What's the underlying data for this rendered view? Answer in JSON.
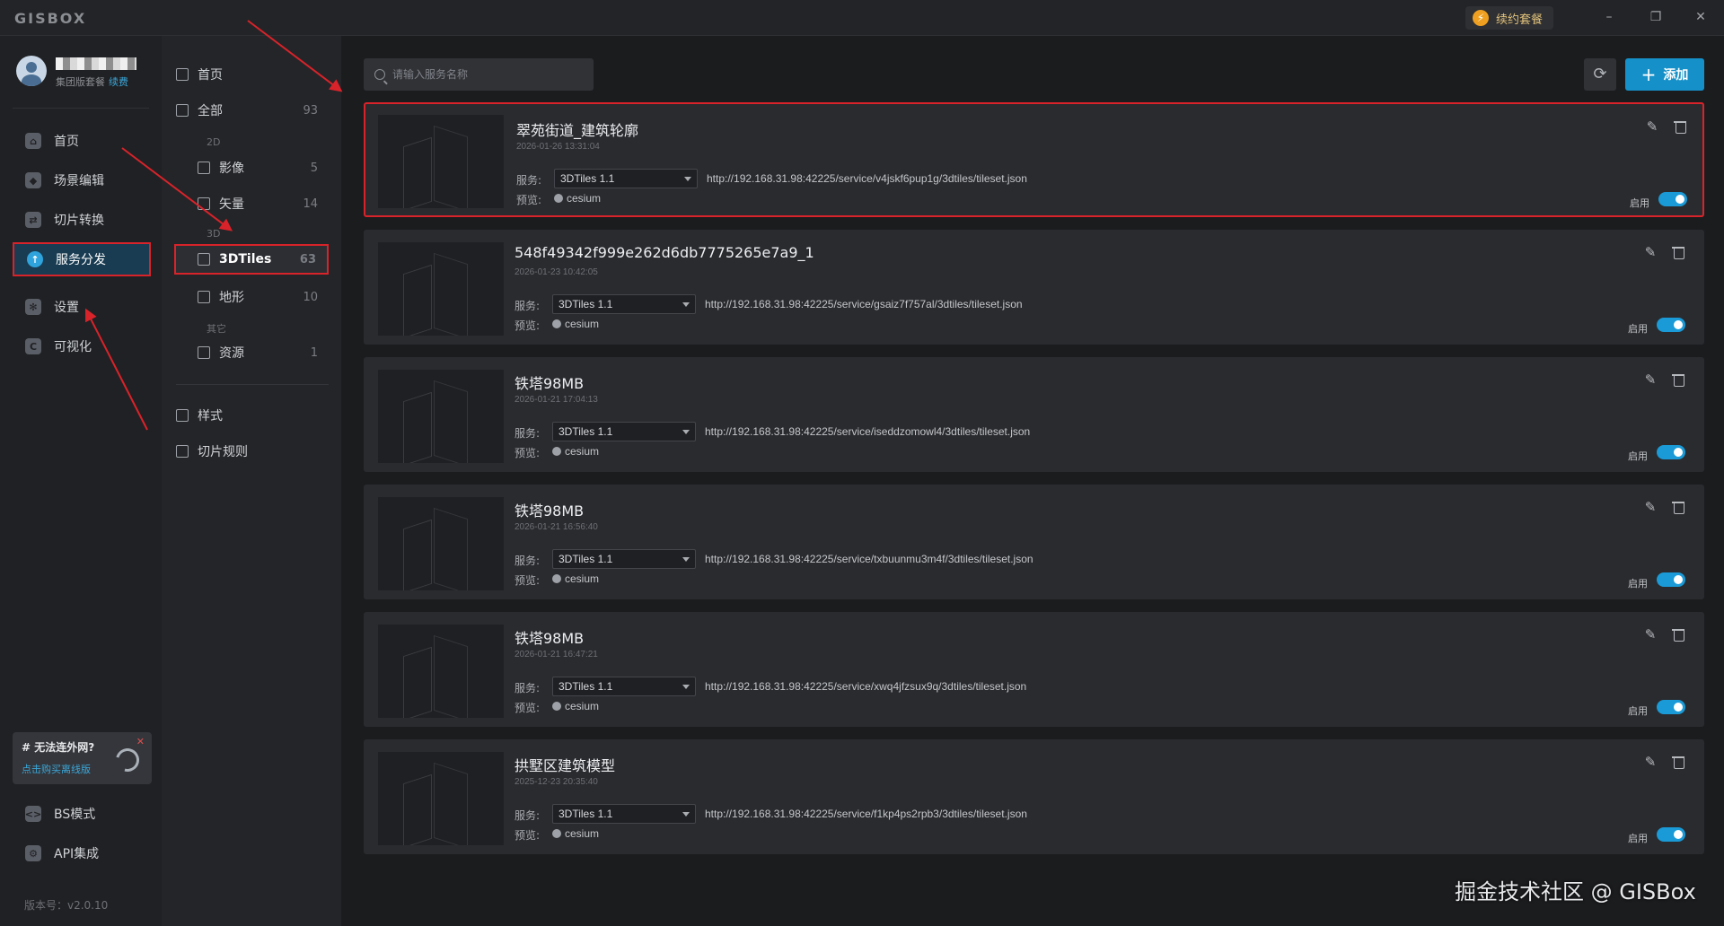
{
  "app": {
    "logo": "GISBOX",
    "renew_label": "续约套餐"
  },
  "window": {
    "minimize": "–",
    "restore": "❐",
    "close": "✕"
  },
  "user": {
    "plan": "集团版套餐",
    "renew_link": "续费"
  },
  "nav": [
    {
      "label": "首页",
      "icon": "home-icon",
      "active": false
    },
    {
      "label": "场景编辑",
      "icon": "cube-icon",
      "active": false
    },
    {
      "label": "切片转换",
      "icon": "convert-icon",
      "active": false
    },
    {
      "label": "服务分发",
      "icon": "upload-icon",
      "active": true
    },
    {
      "label": "设置",
      "icon": "gear-icon",
      "active": false
    },
    {
      "label": "可视化",
      "icon": "visual-icon",
      "active": false
    }
  ],
  "offline": {
    "question": "# 无法连外网?",
    "buy": "点击购买离线版"
  },
  "nav_bottom": [
    {
      "label": "BS模式",
      "icon": "code-icon"
    },
    {
      "label": "API集成",
      "icon": "link-icon"
    }
  ],
  "version": "版本号：v2.0.10",
  "categories": {
    "home": "首页",
    "all": {
      "label": "全部",
      "count": "93"
    },
    "group_2d": "2D",
    "imagery": {
      "label": "影像",
      "count": "5"
    },
    "vector": {
      "label": "矢量",
      "count": "14"
    },
    "group_3d": "3D",
    "tiles3d": {
      "label": "3DTiles",
      "count": "63"
    },
    "terrain": {
      "label": "地形",
      "count": "10"
    },
    "group_other": "其它",
    "resource": {
      "label": "资源",
      "count": "1"
    },
    "style": "样式",
    "slice_rules": "切片规则"
  },
  "search": {
    "placeholder": "请输入服务名称",
    "value": ""
  },
  "toolbar": {
    "refresh": "⟳",
    "add_label": "添加"
  },
  "labels": {
    "service": "服务:",
    "preview": "预览:",
    "enable": "启用"
  },
  "services": [
    {
      "title": "翠苑街道_建筑轮廓",
      "date": "2026-01-26 13:31:04",
      "type": "3DTiles 1.1",
      "url": "http://192.168.31.98:42225/service/v4jskf6pup1g/3dtiles/tileset.json",
      "preview": "cesium",
      "enabled": true
    },
    {
      "title": "548f49342f999e262d6db7775265e7a9_1",
      "date": "2026-01-23 10:42:05",
      "type": "3DTiles 1.1",
      "url": "http://192.168.31.98:42225/service/gsaiz7f757al/3dtiles/tileset.json",
      "preview": "cesium",
      "enabled": true
    },
    {
      "title": "铁塔98MB",
      "date": "2026-01-21 17:04:13",
      "type": "3DTiles 1.1",
      "url": "http://192.168.31.98:42225/service/iseddzomowl4/3dtiles/tileset.json",
      "preview": "cesium",
      "enabled": true
    },
    {
      "title": "铁塔98MB",
      "date": "2026-01-21 16:56:40",
      "type": "3DTiles 1.1",
      "url": "http://192.168.31.98:42225/service/txbuunmu3m4f/3dtiles/tileset.json",
      "preview": "cesium",
      "enabled": true
    },
    {
      "title": "铁塔98MB",
      "date": "2026-01-21 16:47:21",
      "type": "3DTiles 1.1",
      "url": "http://192.168.31.98:42225/service/xwq4jfzsux9q/3dtiles/tileset.json",
      "preview": "cesium",
      "enabled": true
    },
    {
      "title": "拱墅区建筑模型",
      "date": "2025-12-23 20:35:40",
      "type": "3DTiles 1.1",
      "url": "http://192.168.31.98:42225/service/f1kp4ps2rpb3/3dtiles/tileset.json",
      "preview": "cesium",
      "enabled": true
    }
  ],
  "watermark": "掘金技术社区 @ GISBox",
  "colors": {
    "accent": "#1690c8",
    "highlight": "#d8232a",
    "toggle_on": "#1a9ad6"
  }
}
